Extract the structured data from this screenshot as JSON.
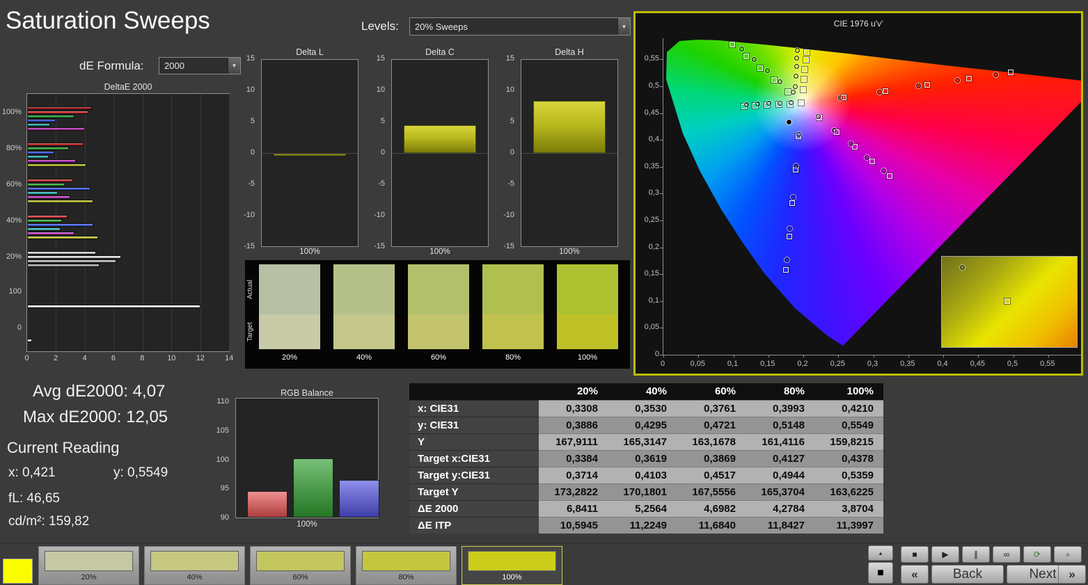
{
  "page": {
    "title": "Saturation Sweeps"
  },
  "controls": {
    "de_formula": {
      "label": "dE Formula:",
      "value": "2000"
    },
    "levels": {
      "label": "Levels:",
      "value": "20% Sweeps"
    },
    "dropdown_arrow": "▼"
  },
  "colors": {
    "accent_yellow": "#bcbc00",
    "bar_yellow": "#b9b91e",
    "panel_bg": "#242424"
  },
  "chart_data": [
    {
      "name": "deltae2000",
      "type": "bar",
      "title": "DeltaE 2000",
      "orientation": "horizontal",
      "xlim": [
        0,
        14
      ],
      "x_ticks": [
        "0",
        "2",
        "4",
        "6",
        "8",
        "10",
        "12",
        "14"
      ],
      "y_labels": [
        "100%",
        "80%",
        "60%",
        "40%",
        "20%",
        "100",
        "0"
      ],
      "groups": [
        {
          "label": "100%",
          "bars": [
            {
              "color": "#a01616",
              "value": 4.5
            },
            {
              "color": "#d23232",
              "value": 4.25
            },
            {
              "color": "#1f9e30",
              "value": 3.3
            },
            {
              "color": "#2d49cf",
              "value": 2.0
            },
            {
              "color": "#23a4a4",
              "value": 1.6
            },
            {
              "color": "#b02cb0",
              "value": 4.0
            }
          ]
        },
        {
          "label": "80%",
          "bars": [
            {
              "color": "#c32222",
              "value": 3.9
            },
            {
              "color": "#27a22e",
              "value": 2.9
            },
            {
              "color": "#3350d8",
              "value": 1.9
            },
            {
              "color": "#28acac",
              "value": 1.5
            },
            {
              "color": "#ba32ba",
              "value": 3.4
            },
            {
              "color": "#b4b422",
              "value": 4.1
            }
          ]
        },
        {
          "label": "60%",
          "bars": [
            {
              "color": "#cc2e2e",
              "value": 3.2
            },
            {
              "color": "#2da82d",
              "value": 2.6
            },
            {
              "color": "#3a57e2",
              "value": 4.4
            },
            {
              "color": "#2fb4b4",
              "value": 2.1
            },
            {
              "color": "#c23ac2",
              "value": 3.0
            },
            {
              "color": "#bcbc2a",
              "value": 4.6
            }
          ]
        },
        {
          "label": "40%",
          "bars": [
            {
              "color": "#d63a3a",
              "value": 2.8
            },
            {
              "color": "#36ae36",
              "value": 2.4
            },
            {
              "color": "#425ee8",
              "value": 4.6
            },
            {
              "color": "#38bcbc",
              "value": 2.3
            },
            {
              "color": "#ca42ca",
              "value": 3.3
            },
            {
              "color": "#c4c432",
              "value": 4.9
            }
          ]
        },
        {
          "label": "20%",
          "bars": [
            {
              "color": "#cfcfcf",
              "value": 4.8
            },
            {
              "color": "#e2e2e2",
              "value": 6.5
            },
            {
              "color": "#bdbdbd",
              "value": 6.2
            },
            {
              "color": "#a8a8a8",
              "value": 5.0
            }
          ]
        },
        {
          "label": "100",
          "bars": [
            {
              "color": "#f2f2f2",
              "value": 12.0
            }
          ]
        },
        {
          "label": "0",
          "bars": [
            {
              "color": "#e6e6e6",
              "value": 0.35
            }
          ]
        }
      ]
    },
    {
      "name": "delta_l",
      "type": "bar",
      "title": "Delta L",
      "ylim": [
        -15,
        15
      ],
      "y_ticks": [
        "15",
        "10",
        "5",
        "0",
        "-5",
        "-10",
        "-15"
      ],
      "x_label": "100%",
      "value": -0.3
    },
    {
      "name": "delta_c",
      "type": "bar",
      "title": "Delta C",
      "ylim": [
        -15,
        15
      ],
      "y_ticks": [
        "15",
        "10",
        "5",
        "0",
        "-5",
        "-10",
        "-15"
      ],
      "x_label": "100%",
      "value": 4.4
    },
    {
      "name": "delta_h",
      "type": "bar",
      "title": "Delta H",
      "ylim": [
        -15,
        15
      ],
      "y_ticks": [
        "15",
        "10",
        "5",
        "0",
        "-5",
        "-10",
        "-15"
      ],
      "x_label": "100%",
      "value": 8.3
    },
    {
      "name": "rgb_balance",
      "type": "bar",
      "title": "RGB Balance",
      "ylim": [
        90,
        110
      ],
      "y_ticks": [
        "110",
        "105",
        "100",
        "95",
        "90"
      ],
      "x_label": "100%",
      "bars": [
        {
          "name": "red",
          "color": "#e85353",
          "value": 94.8
        },
        {
          "name": "green",
          "color": "#2f9e2f",
          "value": 100.4
        },
        {
          "name": "blue",
          "color": "#5353e0",
          "value": 96.7
        }
      ]
    },
    {
      "name": "cie_1976",
      "type": "scatter",
      "title": "CIE 1976 u'v'",
      "xlim": [
        0,
        0.6
      ],
      "ylim": [
        0,
        0.59
      ],
      "x_tick_labels": [
        "0",
        "0,05",
        "0,1",
        "0,15",
        "0,2",
        "0,25",
        "0,3",
        "0,35",
        "0,4",
        "0,45",
        "0,5",
        "0,55"
      ],
      "y_tick_labels": [
        "0",
        "0,05",
        "0,1",
        "0,15",
        "0,2",
        "0,25",
        "0,3",
        "0,35",
        "0,4",
        "0,45",
        "0,5",
        "0,55"
      ],
      "white_point": [
        0.1978,
        0.4683
      ],
      "series": [
        {
          "name": "red-sweep",
          "targets": [
            [
              0.2575,
              0.4797
            ],
            [
              0.3172,
              0.4912
            ],
            [
              0.377,
              0.5026
            ],
            [
              0.4367,
              0.5141
            ],
            [
              0.4964,
              0.5255
            ]
          ],
          "measured": [
            [
              0.2533,
              0.4789
            ],
            [
              0.3088,
              0.4896
            ],
            [
              0.3644,
              0.5002
            ],
            [
              0.42,
              0.5109
            ],
            [
              0.4755,
              0.5215
            ]
          ]
        },
        {
          "name": "green-sweep",
          "targets": [
            [
              0.178,
              0.4902
            ],
            [
              0.1581,
              0.5121
            ],
            [
              0.1383,
              0.5339
            ],
            [
              0.1184,
              0.5558
            ],
            [
              0.0986,
              0.5777
            ]
          ],
          "measured": [
            [
              0.1853,
              0.4886
            ],
            [
              0.1669,
              0.509
            ],
            [
              0.1484,
              0.5293
            ],
            [
              0.13,
              0.5497
            ],
            [
              0.1115,
              0.57
            ]
          ]
        },
        {
          "name": "blue-sweep",
          "targets": [
            [
              0.1933,
              0.4062
            ],
            [
              0.1888,
              0.3441
            ],
            [
              0.1844,
              0.2821
            ],
            [
              0.1799,
              0.22
            ],
            [
              0.1754,
              0.1579
            ]
          ],
          "measured": [
            [
              0.1936,
              0.4099
            ],
            [
              0.1894,
              0.3516
            ],
            [
              0.1852,
              0.2932
            ],
            [
              0.181,
              0.2349
            ],
            [
              0.1767,
              0.1765
            ]
          ]
        },
        {
          "name": "cyan-sweep",
          "targets": [
            [
              0.1812,
              0.467
            ],
            [
              0.1647,
              0.4658
            ],
            [
              0.1481,
              0.4645
            ],
            [
              0.1316,
              0.4633
            ],
            [
              0.115,
              0.462
            ]
          ],
          "measured": [
            [
              0.1821,
              0.4701
            ],
            [
              0.1663,
              0.4689
            ],
            [
              0.1506,
              0.4677
            ],
            [
              0.1349,
              0.4665
            ],
            [
              0.1191,
              0.4653
            ]
          ]
        },
        {
          "name": "magenta-sweep",
          "targets": [
            [
              0.2229,
              0.4412
            ],
            [
              0.248,
              0.4141
            ],
            [
              0.2732,
              0.3871
            ],
            [
              0.2983,
              0.36
            ],
            [
              0.3234,
              0.3329
            ]
          ],
          "measured": [
            [
              0.2212,
              0.4431
            ],
            [
              0.2445,
              0.4179
            ],
            [
              0.2679,
              0.3928
            ],
            [
              0.2912,
              0.3676
            ],
            [
              0.3146,
              0.3424
            ]
          ]
        },
        {
          "name": "yellow-sweep",
          "targets": [
            [
              0.1996,
              0.493
            ],
            [
              0.2011,
              0.5129
            ],
            [
              0.2024,
              0.5316
            ],
            [
              0.2036,
              0.5488
            ],
            [
              0.2047,
              0.5638
            ]
          ],
          "measured": [
            [
              0.189,
              0.4995
            ],
            [
              0.1896,
              0.519
            ],
            [
              0.1901,
              0.537
            ],
            [
              0.1906,
              0.553
            ],
            [
              0.191,
              0.5664
            ]
          ]
        }
      ],
      "extra_markers": [
        {
          "type": "square",
          "uv": [
            0.1978,
            0.4683
          ]
        },
        {
          "type": "dot",
          "uv": [
            0.18,
            0.433
          ]
        }
      ]
    }
  ],
  "swatch_panel": {
    "row_labels": [
      "Actual",
      "Target"
    ],
    "columns": [
      {
        "label": "20%",
        "actual": "#b7c0a5",
        "target": "#c8caa8"
      },
      {
        "label": "40%",
        "actual": "#b5c089",
        "target": "#c6c78a"
      },
      {
        "label": "60%",
        "actual": "#b2c06c",
        "target": "#c3c46c"
      },
      {
        "label": "80%",
        "actual": "#b0c04f",
        "target": "#c1c24d"
      },
      {
        "label": "100%",
        "actual": "#aec131",
        "target": "#bfc127"
      }
    ]
  },
  "stats": {
    "avg": "Avg dE2000: 4,07",
    "max": "Max dE2000: 12,05",
    "current": "Current Reading",
    "x": "x: 0,421",
    "y": "y: 0,5549",
    "fl": "fL: 46,65",
    "cd": "cd/m²: 159,82"
  },
  "table": {
    "columns": [
      "20%",
      "40%",
      "60%",
      "80%",
      "100%"
    ],
    "rows": [
      {
        "label": "x: CIE31",
        "values": [
          "0,3308",
          "0,3530",
          "0,3761",
          "0,3993",
          "0,4210"
        ]
      },
      {
        "label": "y: CIE31",
        "values": [
          "0,3886",
          "0,4295",
          "0,4721",
          "0,5148",
          "0,5549"
        ]
      },
      {
        "label": "Y",
        "values": [
          "167,9111",
          "165,3147",
          "163,1678",
          "161,4116",
          "159,8215"
        ]
      },
      {
        "label": "Target x:CIE31",
        "values": [
          "0,3384",
          "0,3619",
          "0,3869",
          "0,4127",
          "0,4378"
        ]
      },
      {
        "label": "Target y:CIE31",
        "values": [
          "0,3714",
          "0,4103",
          "0,4517",
          "0,4944",
          "0,5359"
        ]
      },
      {
        "label": "Target Y",
        "values": [
          "173,2822",
          "170,1801",
          "167,5556",
          "165,3704",
          "163,6225"
        ]
      },
      {
        "label": "ΔE 2000",
        "values": [
          "6,8411",
          "5,2564",
          "4,6982",
          "4,2784",
          "3,8704"
        ]
      },
      {
        "label": "ΔE ITP",
        "values": [
          "10,5945",
          "11,2249",
          "11,6840",
          "11,8427",
          "11,3997"
        ]
      }
    ]
  },
  "bottom_bar": {
    "patch_color": "#fcfc00",
    "swatches": [
      {
        "label": "20%",
        "color": "#c6c8a3",
        "selected": false
      },
      {
        "label": "40%",
        "color": "#c6c882",
        "selected": false
      },
      {
        "label": "60%",
        "color": "#c4c75f",
        "selected": false
      },
      {
        "label": "80%",
        "color": "#c4c73e",
        "selected": false
      },
      {
        "label": "100%",
        "color": "#cacd1a",
        "selected": true
      }
    ],
    "transport": {
      "options_glyph": "▴",
      "blank_glyph": "■",
      "icons": [
        {
          "name": "stop-icon",
          "glyph": "■",
          "color": "#222222"
        },
        {
          "name": "play-icon",
          "glyph": "▶",
          "color": "#222222"
        },
        {
          "name": "step-icon",
          "glyph": "∥",
          "color": "#222222"
        },
        {
          "name": "loop-icon",
          "glyph": "∞",
          "color": "#222222"
        },
        {
          "name": "refresh-icon",
          "glyph": "⟳",
          "color": "#2e7d2e"
        },
        {
          "name": "record-icon",
          "glyph": "●",
          "color": "#8f8f8f"
        }
      ],
      "prev_glyph": "«",
      "back_label": "Back",
      "next_label": "Next",
      "next_glyph": "»"
    }
  }
}
